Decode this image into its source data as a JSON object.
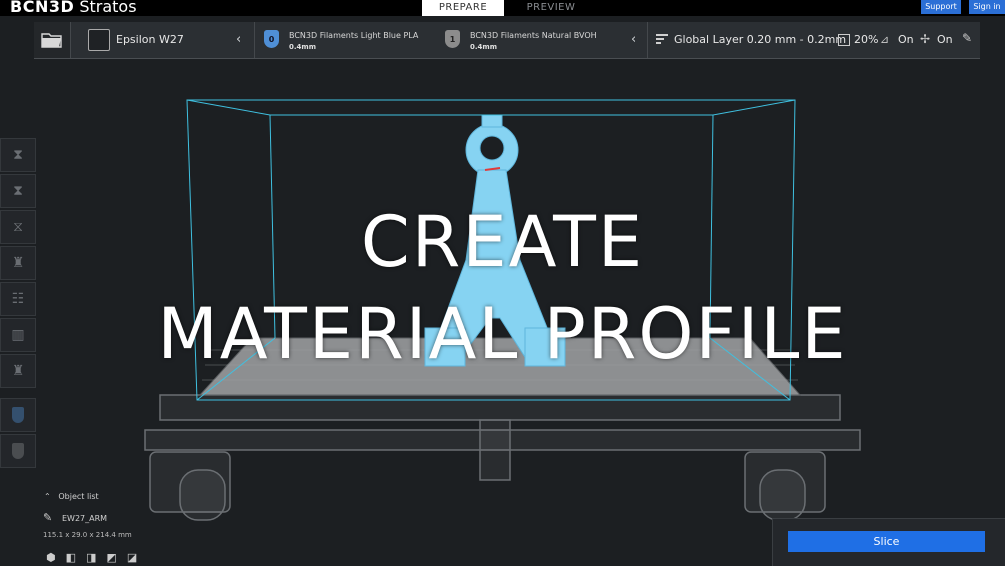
{
  "app": {
    "logo_bold": "BCN3D",
    "logo_rest": " Stratos",
    "tabs": {
      "prepare": "PREPARE",
      "preview": "PREVIEW"
    },
    "support_label": "Support",
    "signin_label": "Sign in"
  },
  "toolbar": {
    "printer_name": "Epsilon W27",
    "extruders": [
      {
        "index": "0",
        "material": "BCN3D Filaments Light Blue PLA",
        "nozzle": "0.4mm",
        "color": "#4f8fd6"
      },
      {
        "index": "1",
        "material": "BCN3D Filaments Natural BVOH",
        "nozzle": "0.4mm",
        "color": "#8c8c8c"
      }
    ],
    "profile": "Global Layer 0.20 mm - 0.2mm",
    "infill": "20%",
    "support": "On",
    "adhesion": "On"
  },
  "overlay": {
    "line1": "CREATE",
    "line2": "MATERIAL PROFILE"
  },
  "object_list": {
    "header": "Object list",
    "object_name": "EW27_ARM",
    "dimensions": "115.1 x 29.0 x 214.4 mm"
  },
  "slice": {
    "label": "Slice"
  },
  "colors": {
    "accent": "#1f6fe5",
    "build_volume": "#3fc0e0",
    "model": "#7fd0f0"
  }
}
